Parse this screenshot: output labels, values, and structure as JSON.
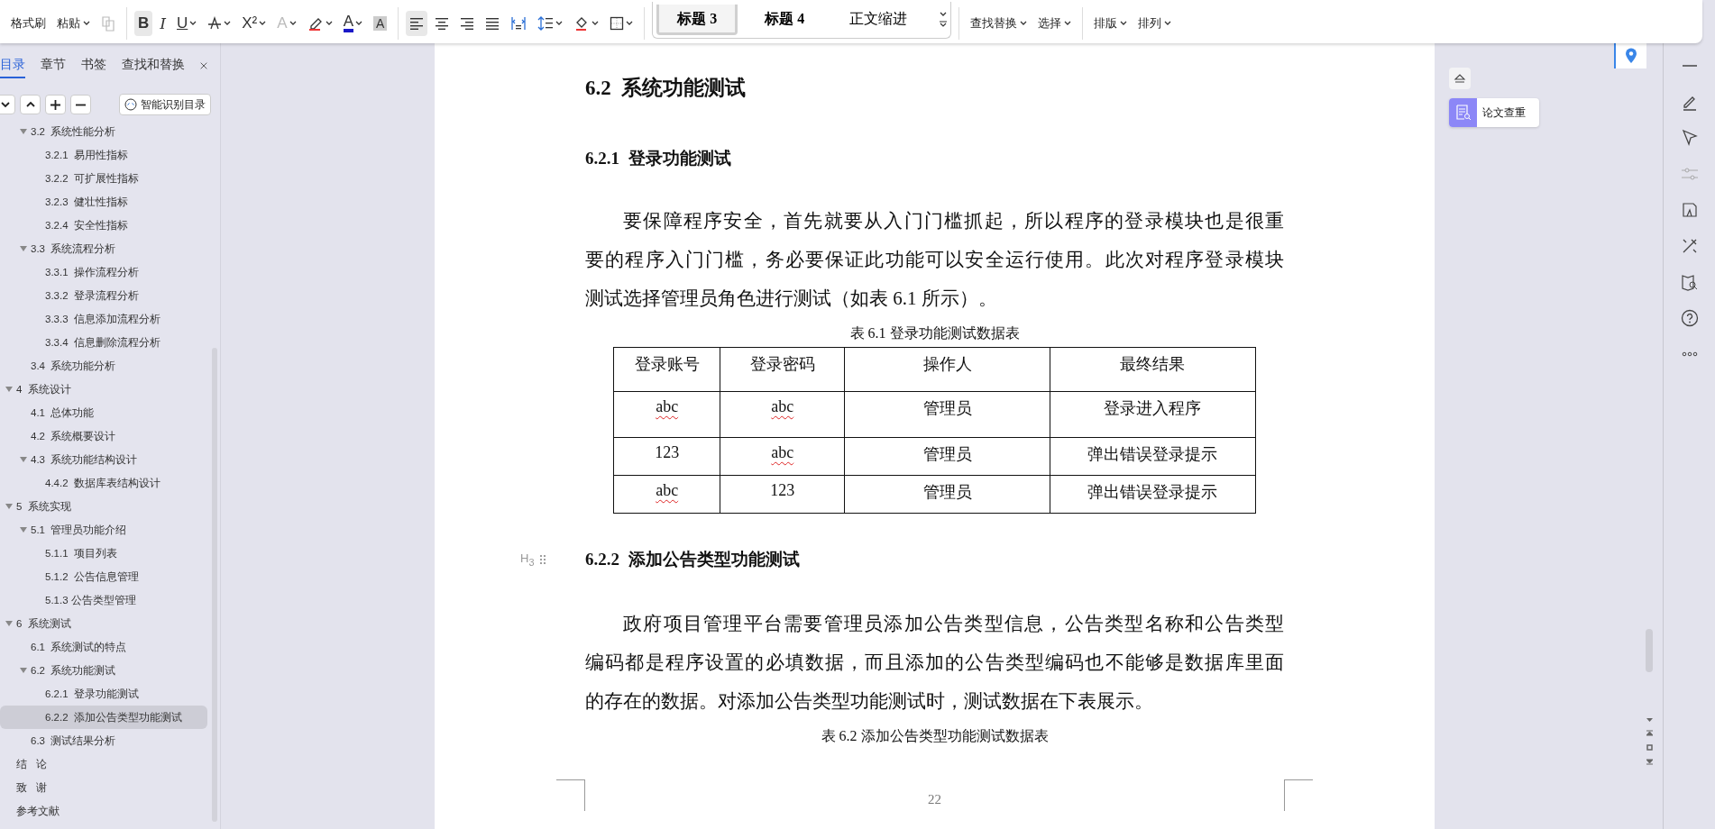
{
  "toolbar": {
    "clipboard": [
      {
        "label": "格式刷",
        "dropdown": false
      },
      {
        "label": "粘贴",
        "dropdown": true
      }
    ],
    "copy_button": {
      "disabled": true
    },
    "font_buttons": [
      {
        "kind": "glyph",
        "glyph": "B",
        "selected": true,
        "dropdown": false,
        "disabled": false
      },
      {
        "kind": "glyph",
        "glyph": "I",
        "selected": false,
        "dropdown": false,
        "disabled": false
      },
      {
        "kind": "glyph",
        "glyph": "U",
        "selected": false,
        "dropdown": true,
        "disabled": false
      },
      {
        "kind": "icon",
        "selected": false,
        "dropdown": true,
        "disabled": false
      },
      {
        "kind": "glyph",
        "glyph": "X²",
        "selected": false,
        "dropdown": true,
        "disabled": false
      },
      {
        "kind": "glyph",
        "glyph": "A",
        "selected": false,
        "dropdown": true,
        "disabled": true
      },
      {
        "kind": "icon",
        "selected": false,
        "dropdown": true,
        "disabled": false
      },
      {
        "kind": "glyph",
        "glyph": "A",
        "selected": false,
        "dropdown": true,
        "disabled": false
      },
      {
        "kind": "glyph",
        "glyph": "A",
        "selected": false,
        "dropdown": false,
        "disabled": false
      }
    ],
    "paragraph_buttons": [
      {
        "selected": true,
        "dropdown": false
      },
      {
        "selected": false,
        "dropdown": false
      },
      {
        "selected": false,
        "dropdown": false
      },
      {
        "selected": false,
        "dropdown": false
      },
      {
        "selected": false,
        "dropdown": false
      },
      {
        "selected": false,
        "dropdown": true
      },
      {
        "selected": false,
        "dropdown": true
      },
      {
        "selected": false,
        "dropdown": true
      }
    ],
    "styles": [
      {
        "label": "标题 3",
        "selected": true
      },
      {
        "label": "标题 4",
        "selected": false
      },
      {
        "label": "正文缩进",
        "selected": false
      }
    ],
    "edit": [
      {
        "label": "查找替换",
        "dropdown": true
      },
      {
        "label": "选择",
        "dropdown": true
      }
    ],
    "arrange": [
      {
        "label": "排版",
        "dropdown": true
      },
      {
        "label": "排列",
        "dropdown": true
      }
    ]
  },
  "sidebar": {
    "tabs": [
      {
        "label": "目录",
        "selected": true
      },
      {
        "label": "章节",
        "selected": false
      },
      {
        "label": "书签",
        "selected": false
      },
      {
        "label": "查找和替换",
        "selected": false
      }
    ],
    "smart_button": "智能识别目录",
    "partial_branch": [
      {
        "label": "3.2  系统性能分析",
        "expanded": true,
        "selected": false,
        "children": [
          {
            "label": "3.2.1  易用性指标",
            "selected": false
          },
          {
            "label": "3.2.2  可扩展性指标",
            "selected": false
          },
          {
            "label": "3.2.3  健壮性指标",
            "selected": false
          },
          {
            "label": "3.2.4  安全性指标",
            "selected": false
          }
        ]
      },
      {
        "label": "3.3  系统流程分析",
        "expanded": true,
        "selected": false,
        "children": [
          {
            "label": "3.3.1  操作流程分析",
            "selected": false
          },
          {
            "label": "3.3.2  登录流程分析",
            "selected": false
          },
          {
            "label": "3.3.3  信息添加流程分析",
            "selected": false
          },
          {
            "label": "3.3.4  信息删除流程分析",
            "selected": false
          }
        ]
      },
      {
        "label": "3.4  系统功能分析",
        "selected": false
      }
    ],
    "items": [
      {
        "label": "4  系统设计",
        "expanded": true,
        "selected": false,
        "children": [
          {
            "label": "4.1  总体功能",
            "selected": false
          },
          {
            "label": "4.2  系统概要设计",
            "selected": false
          },
          {
            "label": "4.3  系统功能结构设计",
            "expanded": true,
            "selected": false,
            "children": [
              {
                "label": "4.4.2  数据库表结构设计",
                "selected": false
              }
            ]
          }
        ]
      },
      {
        "label": "5  系统实现",
        "expanded": true,
        "selected": false,
        "children": [
          {
            "label": "5.1  管理员功能介绍",
            "expanded": true,
            "selected": false,
            "children": [
              {
                "label": "5.1.1  项目列表",
                "selected": false
              },
              {
                "label": "5.1.2  公告信息管理",
                "selected": false
              },
              {
                "label": "5.1.3 公告类型管理",
                "selected": false
              }
            ]
          }
        ]
      },
      {
        "label": "6  系统测试",
        "expanded": true,
        "selected": false,
        "children": [
          {
            "label": "6.1  系统测试的特点",
            "selected": false
          },
          {
            "label": "6.2  系统功能测试",
            "expanded": true,
            "selected": false,
            "children": [
              {
                "label": "6.2.1  登录功能测试",
                "selected": false
              },
              {
                "label": "6.2.2  添加公告类型功能测试",
                "selected": true
              }
            ]
          },
          {
            "label": "6.3  测试结果分析",
            "selected": false
          }
        ]
      },
      {
        "label": "结   论",
        "selected": false
      },
      {
        "label": "致   谢",
        "selected": false
      },
      {
        "label": "参考文献",
        "selected": false
      }
    ]
  },
  "document": {
    "heading": "6.2  系统功能测试",
    "section1": {
      "heading": "6.2.1  登录功能测试",
      "paragraph": [
        "要保障程序安全，首先就要从入门门槛抓起，所以程序的登录模块也是很重",
        "要的程序入门门槛，务必要保证此功能可以安全运行使用。此次对程序登录模块",
        "测试选择管理员角色进行测试（如表 6.1 所示）。"
      ],
      "table_caption": "表 6.1  登录功能测试数据表",
      "columns": [
        "登录账号",
        "登录密码",
        "操作人",
        "最终结果"
      ],
      "rows": [
        [
          {
            "text": "abc",
            "misspelled": true
          },
          {
            "text": "abc",
            "misspelled": true
          },
          {
            "text": "管理员",
            "misspelled": false
          },
          {
            "text": "登录进入程序",
            "misspelled": false
          }
        ],
        [
          {
            "text": "123",
            "misspelled": false
          },
          {
            "text": "abc",
            "misspelled": true
          },
          {
            "text": "管理员",
            "misspelled": false
          },
          {
            "text": "弹出错误登录提示",
            "misspelled": false
          }
        ],
        [
          {
            "text": "abc",
            "misspelled": true
          },
          {
            "text": "123",
            "misspelled": false
          },
          {
            "text": "管理员",
            "misspelled": false
          },
          {
            "text": "弹出错误登录提示",
            "misspelled": false
          }
        ]
      ]
    },
    "section2": {
      "marker": "H$_{3}$",
      "heading": "6.2.2  添加公告类型功能测试",
      "paragraph": [
        "政府项目管理平台需要管理员添加公告类型信息，公告类型名称和公告类型",
        "编码都是程序设置的必填数据，而且添加的公告类型编码也不能够是数据库里面",
        "的存在的数据。对添加公告类型功能测试时，测试数据在下表展示。"
      ],
      "table_caption": "表 6.2  添加公告类型功能测试数据表"
    },
    "page_number": "22"
  },
  "side_panel": {
    "check_card": "论文查重"
  }
}
